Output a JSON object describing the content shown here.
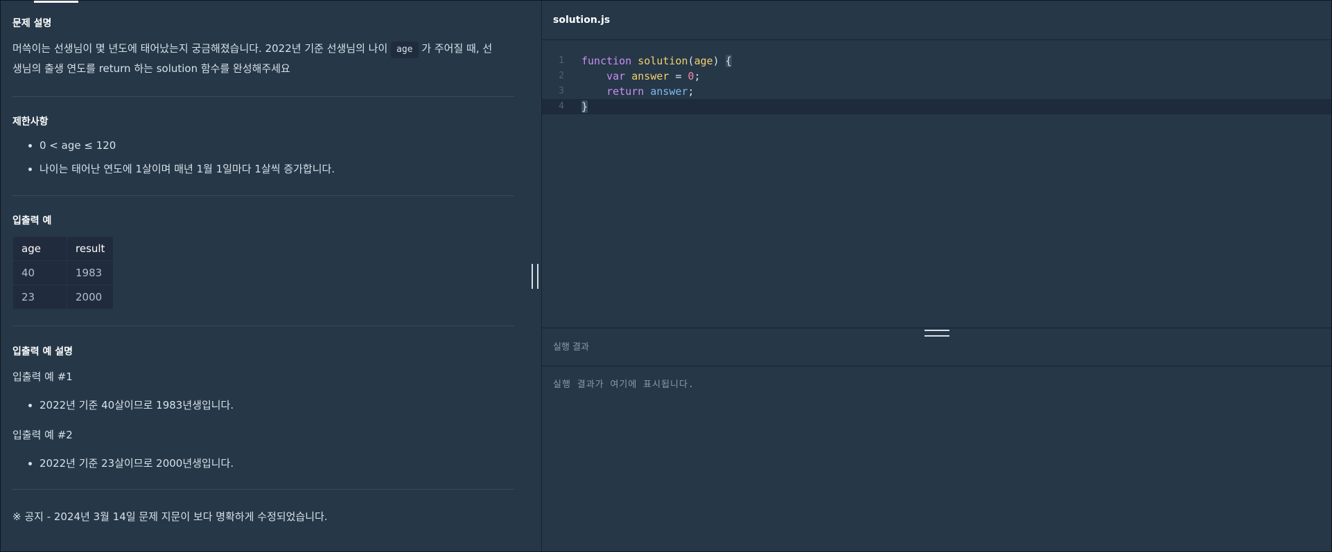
{
  "problem": {
    "description_title": "문제 설명",
    "description_part1": "머쓱이는 선생님이 몇 년도에 태어났는지 궁금해졌습니다. 2022년 기준 선생님의 나이 ",
    "description_code": "age",
    "description_part2": " 가 주어질 때, 선",
    "description_line2": "생님의 출생 연도를 return 하는 solution 함수를 완성해주세요",
    "constraints_title": "제한사항",
    "constraints": [
      "0 < age ≤ 120",
      "나이는 태어난 연도에 1살이며 매년 1월 1일마다 1살씩 증가합니다."
    ],
    "io_title": "입출력 예",
    "io_table": {
      "headers": [
        "age",
        "result"
      ],
      "rows": [
        [
          "40",
          "1983"
        ],
        [
          "23",
          "2000"
        ]
      ]
    },
    "io_explain_title": "입출력 예 설명",
    "examples": [
      {
        "label": "입출력 예 #1",
        "text": "2022년 기준 40살이므로 1983년생입니다."
      },
      {
        "label": "입출력 예 #2",
        "text": "2022년 기준 23살이므로 2000년생입니다."
      }
    ],
    "notice": "※ 공지 - 2024년 3월 14일 문제 지문이 보다 명확하게 수정되었습니다."
  },
  "editor": {
    "filename": "solution.js",
    "line_numbers": [
      "1",
      "2",
      "3",
      "4"
    ],
    "tokens": {
      "function_kw": "function",
      "function_name": "solution",
      "param": "age",
      "var_kw": "var",
      "var_name": "answer",
      "zero": "0",
      "return_kw": "return",
      "return_val": "answer"
    }
  },
  "result": {
    "title": "실행 결과",
    "placeholder": "실행 결과가 여기에 표시됩니다."
  },
  "colors": {
    "background": "#263747",
    "keyword": "#c98ff2",
    "function": "#f2d16e",
    "number": "#f08ab3",
    "identifier": "#7fb9f0"
  }
}
